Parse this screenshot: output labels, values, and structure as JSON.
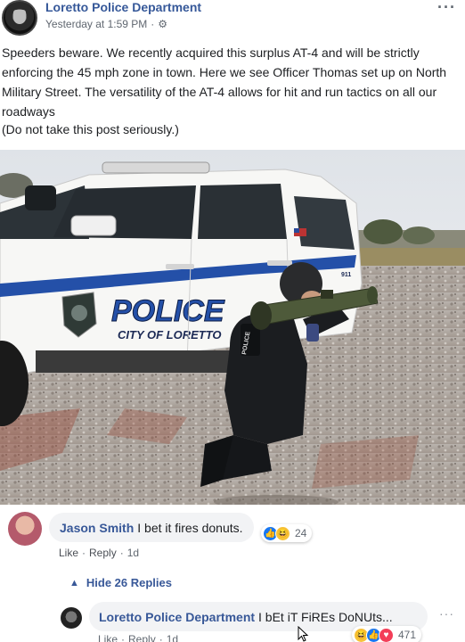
{
  "post": {
    "page_name": "Loretto Police Department",
    "timestamp": "Yesterday at 1:59 PM",
    "separator": "·",
    "more": "···",
    "text": "Speeders beware. We recently acquired this surplus AT-4 and will be strictly enforcing the 45 mph zone in town. Here we see Officer Thomas set up on North Military Street. The versatility of the AT-4 allows for hit and run tactics on all our roadways",
    "note": "(Do not take this post seriously.)"
  },
  "photo": {
    "door_text": "POLICE",
    "door_subtext": "CITY OF LORETTO",
    "vest_text": "POLICE",
    "unit_number": "911"
  },
  "comment": {
    "author": "Jason Smith",
    "text": "I bet it fires donuts.",
    "reaction_count": "24",
    "like": "Like",
    "reply": "Reply",
    "dot": "·",
    "age": "1d"
  },
  "replies_toggle": {
    "label": "Hide 26 Replies"
  },
  "reply": {
    "author": "Loretto Police Department",
    "text": "I bEt iT FiREs DoNUts...",
    "reaction_count": "471",
    "like": "Like",
    "reply": "Reply",
    "dot": "·",
    "age": "1d",
    "more": "···"
  },
  "colors": {
    "link_blue": "#385898",
    "bubble_gray": "#f2f3f5",
    "like_blue": "#1877f2",
    "love_red": "#f33e58",
    "haha_yellow": "#f7c33a"
  }
}
